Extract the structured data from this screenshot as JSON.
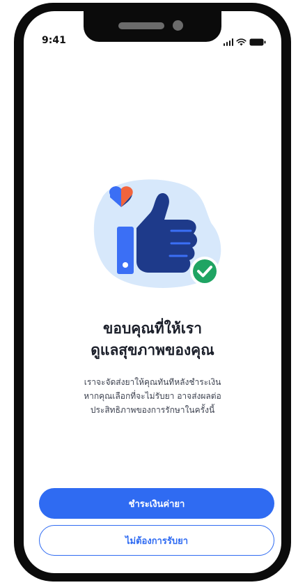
{
  "status_bar": {
    "time": "9:41",
    "icons": [
      "signal-icon",
      "wifi-icon",
      "battery-icon"
    ]
  },
  "illustration": {
    "name": "thumbs-up-heart-check-illustration",
    "colors": {
      "blob": "#d7e8fb",
      "thumb": "#1e3a8a",
      "cuff": "#3b6ff5",
      "heart_left": "#3b6ff5",
      "heart_right": "#f2643c",
      "check_badge": "#1fa463"
    }
  },
  "content": {
    "title_line1": "ขอบคุณที่ให้เรา",
    "title_line2": "ดูแลสุขภาพของคุณ",
    "description_line1": "เราจะจัดส่งยาให้คุณทันทีหลังชำระเงิน",
    "description_line2": "หากคุณเลือกที่จะไม่รับยา อาจส่งผลต่อ",
    "description_line3": "ประสิทธิภาพของการรักษาในครั้งนี้"
  },
  "actions": {
    "pay_label": "ชำระเงินค่ายา",
    "decline_label": "ไม่ต้องการรับยา"
  },
  "colors": {
    "accent": "#2f6bf2",
    "frame": "#0b0b0b"
  }
}
